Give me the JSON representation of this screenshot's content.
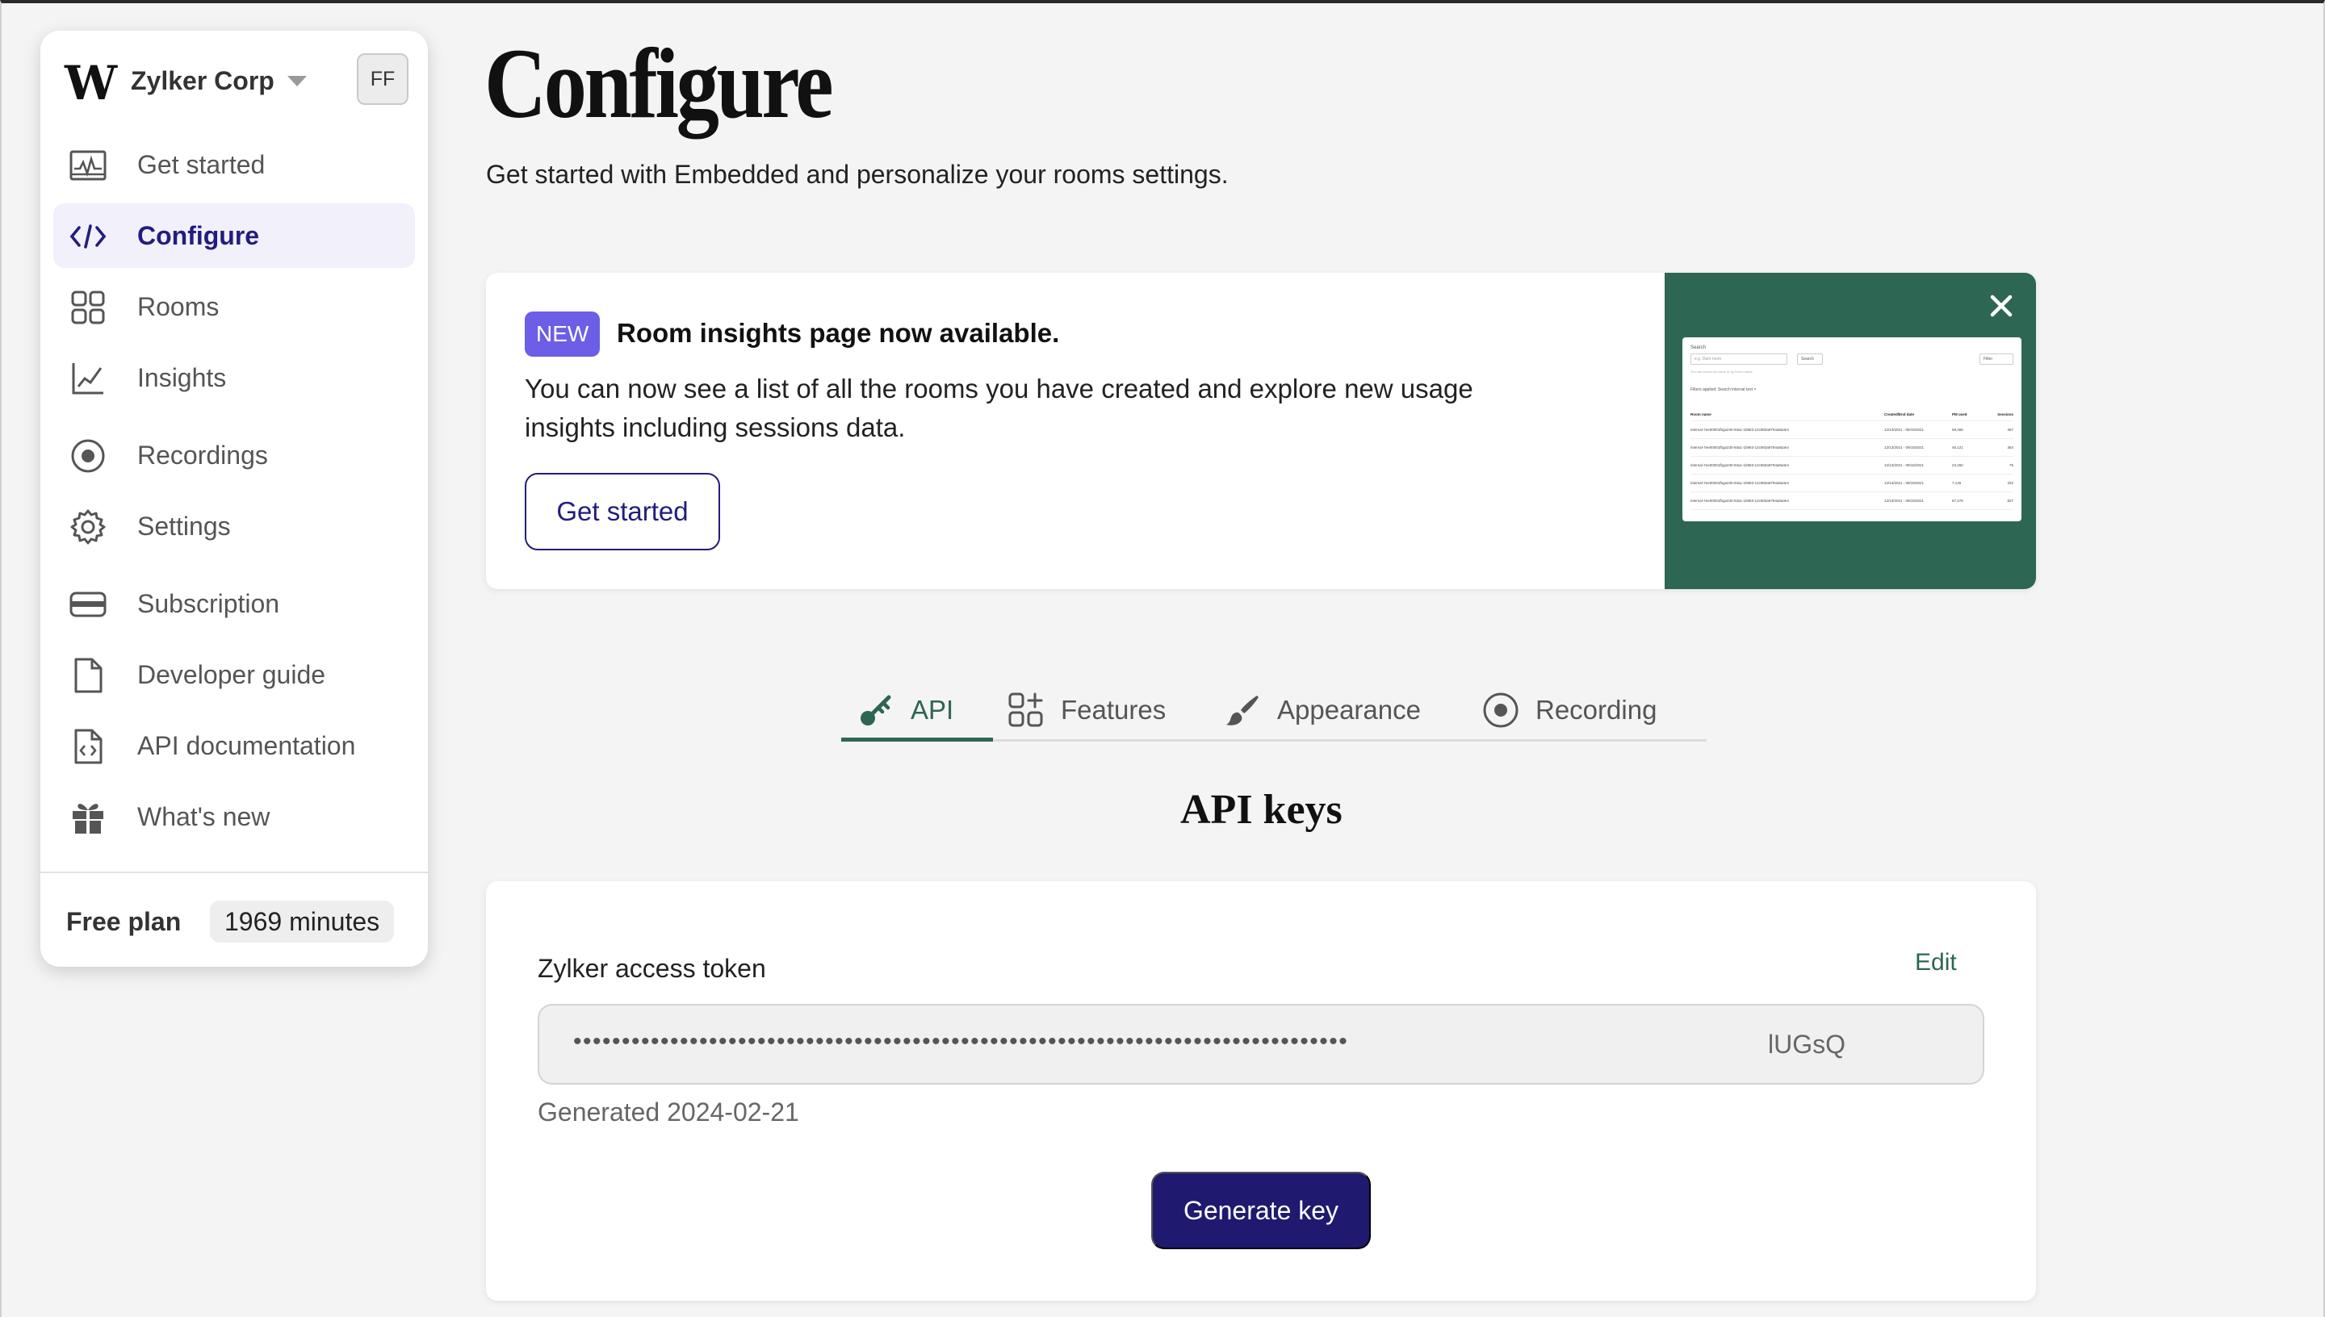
{
  "sidebar": {
    "logo": "W",
    "org_name": "Zylker Corp",
    "avatar_initials": "FF",
    "items": [
      {
        "label": "Get started",
        "icon": "dashboard-chart-icon"
      },
      {
        "label": "Configure",
        "icon": "code-icon",
        "active": true
      },
      {
        "label": "Rooms",
        "icon": "grid-icon"
      },
      {
        "label": "Insights",
        "icon": "line-chart-icon"
      },
      {
        "label": "Recordings",
        "icon": "record-icon"
      },
      {
        "label": "Settings",
        "icon": "gear-icon"
      },
      {
        "label": "Subscription",
        "icon": "credit-card-icon"
      },
      {
        "label": "Developer guide",
        "icon": "document-icon"
      },
      {
        "label": "API documentation",
        "icon": "code-document-icon"
      },
      {
        "label": "What's new",
        "icon": "gift-icon"
      }
    ],
    "plan_label": "Free plan",
    "plan_minutes": "1969 minutes"
  },
  "header": {
    "title": "Configure",
    "subtitle": "Get started with Embedded and personalize your rooms settings."
  },
  "banner": {
    "badge": "NEW",
    "title": "Room insights page now available.",
    "text": "You can now see a list of all the rooms you have created and explore new usage insights including sessions data.",
    "button": "Get started",
    "preview": {
      "search_label": "Search",
      "search_placeholder": "e.g. Dam room",
      "search_button": "Search",
      "filter_button": "Filter",
      "hint": "You can search by name or by Room name",
      "filters_applied": "Filters applied:   Search internal test  ×",
      "columns": [
        "Room name",
        "Created/End date",
        "PM used",
        "Sessions"
      ],
      "rows": [
        [
          "internal-7ee00001fbga230-93a1-1b983-12c983a9794a8a3e4",
          "12/13/2021 - 09/15/2021",
          "69,466",
          "467"
        ],
        [
          "internal-7ee00001fbga230-93a1-1b983-12c983a9794a8a3e4",
          "12/13/2021 - 09/15/2021",
          "46,121",
          "364"
        ],
        [
          "internal-7ee00001fbga230-93a1-1b983-12c983a9794a8a3e4",
          "12/13/2021 - 09/15/2021",
          "23,260",
          "75"
        ],
        [
          "internal-7ee00001fbga230-93a1-1b983-12c983a9794a8a3e4",
          "12/13/2021 - 09/15/2021",
          "7,146",
          "332"
        ],
        [
          "internal-7ee00001fbga230-93a1-1b983-12c983a9794a8a3e4",
          "12/13/2021 - 09/15/2021",
          "67,275",
          "827"
        ]
      ]
    }
  },
  "tabs": [
    {
      "label": "API",
      "icon": "key-icon",
      "active": true
    },
    {
      "label": "Features",
      "icon": "features-icon"
    },
    {
      "label": "Appearance",
      "icon": "paintbrush-icon"
    },
    {
      "label": "Recording",
      "icon": "record-icon"
    }
  ],
  "api_keys": {
    "section_title": "API keys",
    "token_label": "Zylker access token",
    "edit_label": "Edit",
    "token_masked": "••••••••••••••••••••••••••••••••••••••••••••••••••••••••••••••••••••••••••••••••",
    "token_suffix": "lUGsQ",
    "generated": "Generated 2024-02-21",
    "generate_button": "Generate key"
  },
  "colors": {
    "brand_navy": "#1f1a6f",
    "accent_green": "#2d6653",
    "badge_purple": "#6c5ee6",
    "active_nav_bg": "#f1f0fb"
  }
}
